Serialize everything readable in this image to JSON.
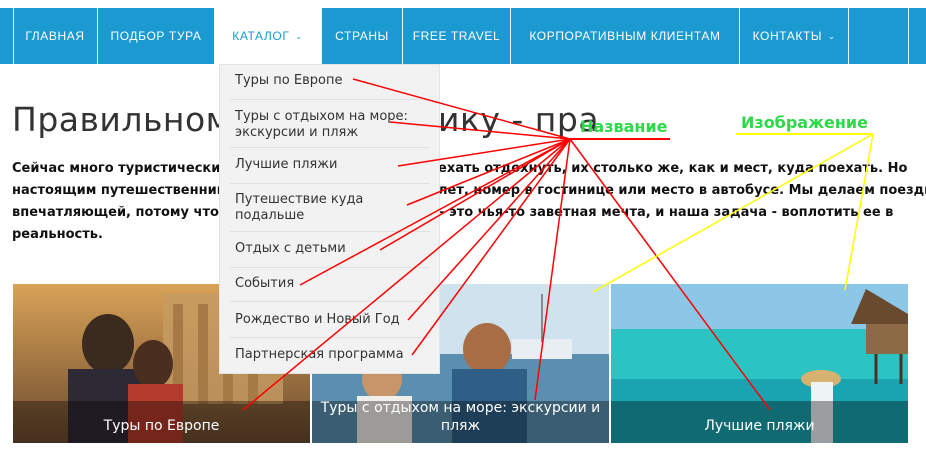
{
  "nav": {
    "items": [
      {
        "label": "ГЛАВНАЯ",
        "dropdown": false
      },
      {
        "label": "ПОДБОР ТУРА",
        "dropdown": false
      },
      {
        "label": "КАТАЛОГ",
        "dropdown": true
      },
      {
        "label": "СТРАНЫ",
        "dropdown": false
      },
      {
        "label": "FREE TRAVEL",
        "dropdown": false
      },
      {
        "label": "КОРПОРАТИВНЫМ КЛИЕНТАМ",
        "dropdown": false
      },
      {
        "label": "КОНТАКТЫ",
        "dropdown": true
      }
    ],
    "active_index": 2,
    "chevron": "⌄"
  },
  "page": {
    "heading_start": "Правильному",
    "heading_end": "ику - пра",
    "intro_lines": [
      {
        "left": "Сейчас много туристических ко",
        "right": "ехать отдохнуть, их столько же, как и мест, куда поехать. Но"
      },
      {
        "left": "настоящим путешественникам",
        "right": "лет, номер в гостинице или место в автобусе. Мы делаем поездку"
      },
      {
        "left": "впечатляющей, потому что уве",
        "right": "– это чья-то заветная мечта, и наша задача - воплотить ее в"
      },
      {
        "left": "реальность.",
        "right": ""
      }
    ]
  },
  "dropdown": {
    "items": [
      "Туры по Европе",
      "Туры с отдыхом на море: экскурсии и пляж",
      "Лучшие пляжи",
      "Путешествие куда подальше",
      "Отдых с детьми",
      "События",
      "Рождество и Новый Год",
      "Партнерская программа"
    ]
  },
  "cards": [
    {
      "caption": "Туры по Европе",
      "scene": "ancient-ruins-travelers"
    },
    {
      "caption": "Туры с отдыхом на море: экскурсии и пляж",
      "scene": "boat-sea-people"
    },
    {
      "caption": "Лучшие пляжи",
      "scene": "tropical-beach-bungalows"
    }
  ],
  "annotations": {
    "name_label": "Название",
    "image_label": "Изображение",
    "name_color": "#ff0000",
    "image_color": "#ffff00",
    "label_color": "#2dd94a"
  },
  "colors": {
    "nav_bg": "#1a9ad0",
    "dropdown_bg": "#f2f2f2"
  }
}
